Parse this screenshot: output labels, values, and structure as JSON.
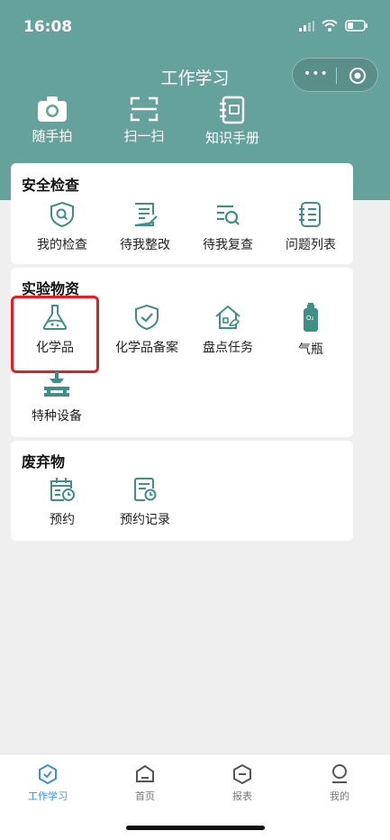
{
  "status": {
    "time": "16:08"
  },
  "header": {
    "title": "工作学习",
    "capsule_more": "•••"
  },
  "quick_actions": [
    {
      "label": "随手拍",
      "icon": "camera-icon"
    },
    {
      "label": "扫一扫",
      "icon": "scan-icon"
    },
    {
      "label": "知识手册",
      "icon": "notebook-icon"
    }
  ],
  "sections": {
    "safety": {
      "title": "安全检查",
      "items": [
        {
          "label": "我的检查",
          "icon": "shield-search-icon"
        },
        {
          "label": "待我整改",
          "icon": "edit-list-icon"
        },
        {
          "label": "待我复查",
          "icon": "list-search-icon"
        },
        {
          "label": "问题列表",
          "icon": "clipboard-list-icon"
        }
      ]
    },
    "materials": {
      "title": "实验物资",
      "items": [
        {
          "label": "化学品",
          "icon": "flask-icon"
        },
        {
          "label": "化学品备案",
          "icon": "shield-check-icon"
        },
        {
          "label": "盘点任务",
          "icon": "house-leaf-icon"
        },
        {
          "label": "气瓶",
          "icon": "gas-cylinder-icon"
        },
        {
          "label": "特种设备",
          "icon": "machine-icon"
        }
      ]
    },
    "waste": {
      "title": "废弃物",
      "items": [
        {
          "label": "预约",
          "icon": "calendar-clock-icon"
        },
        {
          "label": "预约记录",
          "icon": "record-clock-icon"
        }
      ]
    }
  },
  "tabs": [
    {
      "label": "工作学习",
      "active": true,
      "icon": "hexagon-check-icon"
    },
    {
      "label": "首页",
      "active": false,
      "icon": "home-box-icon"
    },
    {
      "label": "报表",
      "active": false,
      "icon": "hexagon-minus-icon"
    },
    {
      "label": "我的",
      "active": false,
      "icon": "user-icon"
    }
  ],
  "colors": {
    "header_bg": "#66a29c",
    "icon": "#3f8f87",
    "active_tab": "#3b8ee6",
    "highlight": "#e02020"
  }
}
